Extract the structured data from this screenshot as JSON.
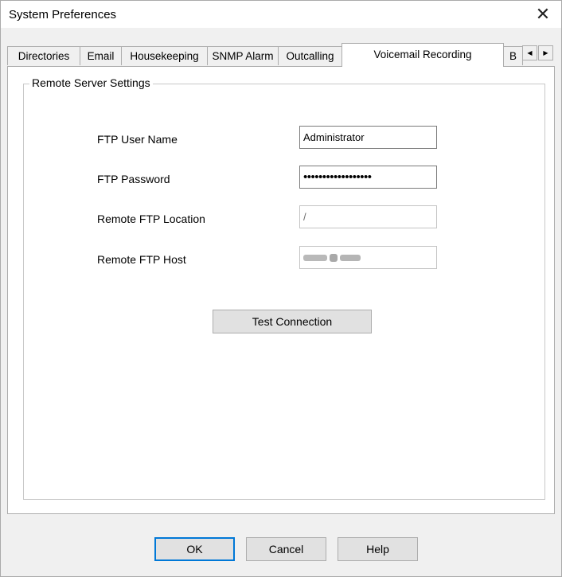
{
  "window": {
    "title": "System Preferences"
  },
  "tabs": [
    {
      "label": "Directories"
    },
    {
      "label": "Email"
    },
    {
      "label": "Housekeeping"
    },
    {
      "label": "SNMP Alarm"
    },
    {
      "label": "Outcalling"
    },
    {
      "label": "Voicemail Recording",
      "active": true
    },
    {
      "label": "B"
    }
  ],
  "group": {
    "label": "Remote Server Settings"
  },
  "fields": {
    "ftp_user_name": {
      "label": "FTP User Name",
      "value": "Administrator"
    },
    "ftp_password": {
      "label": "FTP Password",
      "value": "••••••••••••••••••"
    },
    "remote_ftp_location": {
      "label": "Remote FTP Location",
      "value": "/"
    },
    "remote_ftp_host": {
      "label": "Remote FTP Host"
    }
  },
  "actions": {
    "test_connection": "Test Connection"
  },
  "footer": {
    "ok": "OK",
    "cancel": "Cancel",
    "help": "Help"
  },
  "icons": {
    "close": "close-icon",
    "scroll_left": "arrow-left-icon",
    "scroll_right": "arrow-right-icon"
  },
  "colors": {
    "accent": "#0078d7",
    "panel": "#ffffff",
    "window_bg": "#f0f0f0"
  }
}
